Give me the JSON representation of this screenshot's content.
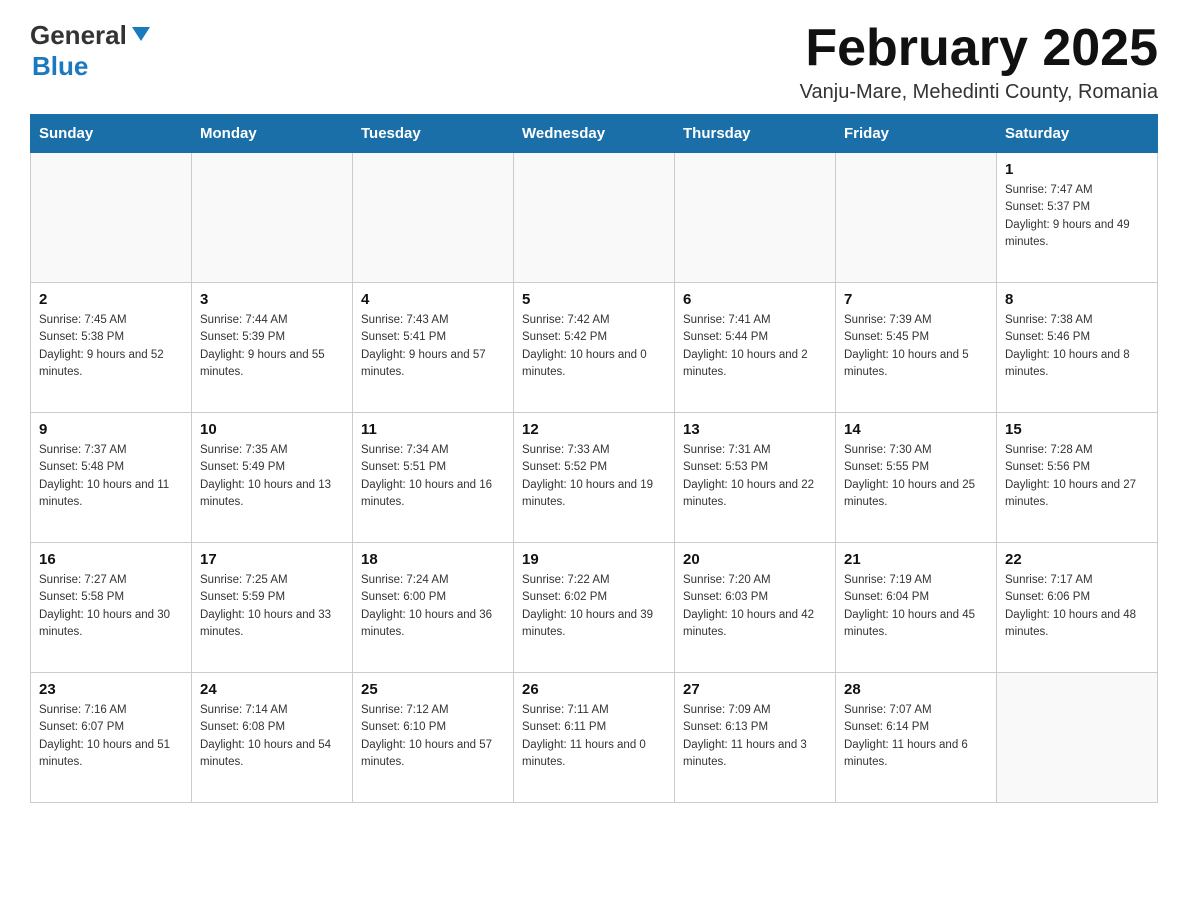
{
  "header": {
    "logo_general": "General",
    "logo_blue": "Blue",
    "month_title": "February 2025",
    "location": "Vanju-Mare, Mehedinti County, Romania"
  },
  "days_of_week": [
    "Sunday",
    "Monday",
    "Tuesday",
    "Wednesday",
    "Thursday",
    "Friday",
    "Saturday"
  ],
  "weeks": [
    [
      {
        "day": "",
        "info": ""
      },
      {
        "day": "",
        "info": ""
      },
      {
        "day": "",
        "info": ""
      },
      {
        "day": "",
        "info": ""
      },
      {
        "day": "",
        "info": ""
      },
      {
        "day": "",
        "info": ""
      },
      {
        "day": "1",
        "info": "Sunrise: 7:47 AM\nSunset: 5:37 PM\nDaylight: 9 hours and 49 minutes."
      }
    ],
    [
      {
        "day": "2",
        "info": "Sunrise: 7:45 AM\nSunset: 5:38 PM\nDaylight: 9 hours and 52 minutes."
      },
      {
        "day": "3",
        "info": "Sunrise: 7:44 AM\nSunset: 5:39 PM\nDaylight: 9 hours and 55 minutes."
      },
      {
        "day": "4",
        "info": "Sunrise: 7:43 AM\nSunset: 5:41 PM\nDaylight: 9 hours and 57 minutes."
      },
      {
        "day": "5",
        "info": "Sunrise: 7:42 AM\nSunset: 5:42 PM\nDaylight: 10 hours and 0 minutes."
      },
      {
        "day": "6",
        "info": "Sunrise: 7:41 AM\nSunset: 5:44 PM\nDaylight: 10 hours and 2 minutes."
      },
      {
        "day": "7",
        "info": "Sunrise: 7:39 AM\nSunset: 5:45 PM\nDaylight: 10 hours and 5 minutes."
      },
      {
        "day": "8",
        "info": "Sunrise: 7:38 AM\nSunset: 5:46 PM\nDaylight: 10 hours and 8 minutes."
      }
    ],
    [
      {
        "day": "9",
        "info": "Sunrise: 7:37 AM\nSunset: 5:48 PM\nDaylight: 10 hours and 11 minutes."
      },
      {
        "day": "10",
        "info": "Sunrise: 7:35 AM\nSunset: 5:49 PM\nDaylight: 10 hours and 13 minutes."
      },
      {
        "day": "11",
        "info": "Sunrise: 7:34 AM\nSunset: 5:51 PM\nDaylight: 10 hours and 16 minutes."
      },
      {
        "day": "12",
        "info": "Sunrise: 7:33 AM\nSunset: 5:52 PM\nDaylight: 10 hours and 19 minutes."
      },
      {
        "day": "13",
        "info": "Sunrise: 7:31 AM\nSunset: 5:53 PM\nDaylight: 10 hours and 22 minutes."
      },
      {
        "day": "14",
        "info": "Sunrise: 7:30 AM\nSunset: 5:55 PM\nDaylight: 10 hours and 25 minutes."
      },
      {
        "day": "15",
        "info": "Sunrise: 7:28 AM\nSunset: 5:56 PM\nDaylight: 10 hours and 27 minutes."
      }
    ],
    [
      {
        "day": "16",
        "info": "Sunrise: 7:27 AM\nSunset: 5:58 PM\nDaylight: 10 hours and 30 minutes."
      },
      {
        "day": "17",
        "info": "Sunrise: 7:25 AM\nSunset: 5:59 PM\nDaylight: 10 hours and 33 minutes."
      },
      {
        "day": "18",
        "info": "Sunrise: 7:24 AM\nSunset: 6:00 PM\nDaylight: 10 hours and 36 minutes."
      },
      {
        "day": "19",
        "info": "Sunrise: 7:22 AM\nSunset: 6:02 PM\nDaylight: 10 hours and 39 minutes."
      },
      {
        "day": "20",
        "info": "Sunrise: 7:20 AM\nSunset: 6:03 PM\nDaylight: 10 hours and 42 minutes."
      },
      {
        "day": "21",
        "info": "Sunrise: 7:19 AM\nSunset: 6:04 PM\nDaylight: 10 hours and 45 minutes."
      },
      {
        "day": "22",
        "info": "Sunrise: 7:17 AM\nSunset: 6:06 PM\nDaylight: 10 hours and 48 minutes."
      }
    ],
    [
      {
        "day": "23",
        "info": "Sunrise: 7:16 AM\nSunset: 6:07 PM\nDaylight: 10 hours and 51 minutes."
      },
      {
        "day": "24",
        "info": "Sunrise: 7:14 AM\nSunset: 6:08 PM\nDaylight: 10 hours and 54 minutes."
      },
      {
        "day": "25",
        "info": "Sunrise: 7:12 AM\nSunset: 6:10 PM\nDaylight: 10 hours and 57 minutes."
      },
      {
        "day": "26",
        "info": "Sunrise: 7:11 AM\nSunset: 6:11 PM\nDaylight: 11 hours and 0 minutes."
      },
      {
        "day": "27",
        "info": "Sunrise: 7:09 AM\nSunset: 6:13 PM\nDaylight: 11 hours and 3 minutes."
      },
      {
        "day": "28",
        "info": "Sunrise: 7:07 AM\nSunset: 6:14 PM\nDaylight: 11 hours and 6 minutes."
      },
      {
        "day": "",
        "info": ""
      }
    ]
  ]
}
